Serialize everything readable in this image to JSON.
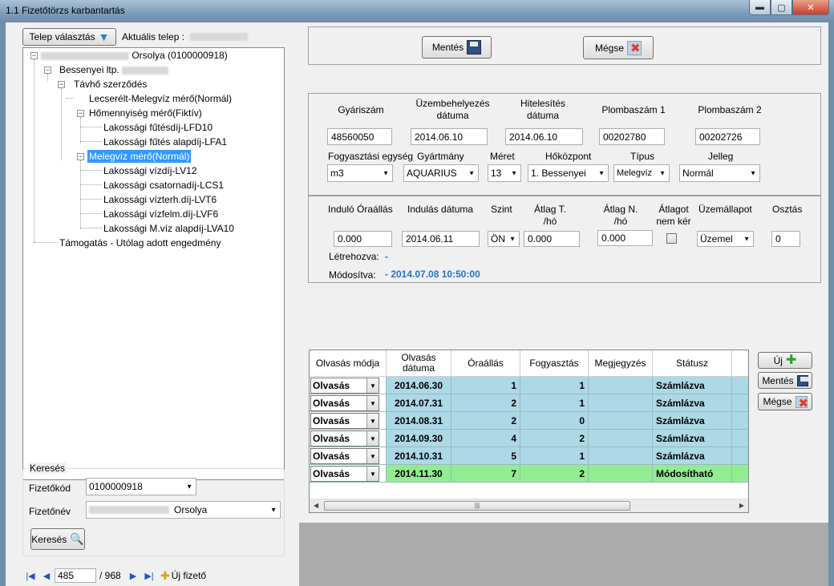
{
  "window": {
    "title": "1.1 Fizetőtörzs karbantartás",
    "buttons": {
      "minimize": "▬",
      "maximize": "▢",
      "close": "✕"
    }
  },
  "left": {
    "telep_button": "Telep választás",
    "aktualis_label": "Aktuális telep :",
    "tree": {
      "root": "Orsolya (0100000918)",
      "bessenyei": "Bessenyei ltp.",
      "tavho": "Távhő szerződés",
      "lecserelt": "Lecserélt-Melegvíz mérő(Normál)",
      "homennyiseg": "Hőmennyiség mérő(Fiktív)",
      "futesdij": "Lakossági fűtésdíj-LFD10",
      "futesalap": "Lakossági fűtés alapdíj-LFA1",
      "melegviz": "Melegvíz mérő(Normál)",
      "vizdij": "Lakossági vízdíj-LV12",
      "csatorna": "Lakossági csatornadíj-LCS1",
      "vizterh": "Lakossági vízterh.díj-LVT6",
      "vizfelm": "Lakossági vízfelm.díj-LVF6",
      "mviz": "Lakossági M.víz alapdíj-LVA10",
      "tamogatas": "Támogatás - Utólag adott engedmény"
    },
    "search": {
      "group_title": "Keresés",
      "kod_label": "Fizetőkód",
      "kod_value": "0100000918",
      "nev_label": "Fizetőnév",
      "nev_value": "Orsolya",
      "button": "Keresés"
    },
    "nav": {
      "current": "485",
      "total": "/ 968",
      "new_payer": "Új fizető"
    }
  },
  "toolbar": {
    "save": "Mentés",
    "cancel": "Mégse"
  },
  "meter": {
    "headers": {
      "gyariszam": "Gyáriszám",
      "uzembe": "Üzembehelyezés dátuma",
      "hiteles": "Hitelesítés dátuma",
      "plomba1": "Plombaszám 1",
      "plomba2": "Plombaszám 2",
      "fogy_egyseg": "Fogyasztási egység",
      "gyartmany": "Gyártmány",
      "meret": "Méret",
      "hokozpont": "Hőközpont",
      "tipus": "Típus",
      "jelleg": "Jelleg"
    },
    "values": {
      "gyariszam": "48560050",
      "uzembe": "2014.06.10",
      "hiteles": "2014.06.10",
      "plomba1": "00202780",
      "plomba2": "00202726",
      "fogy_egyseg": "m3",
      "gyartmany": "AQUARIUS",
      "meret": "13",
      "hokozpont": "1. Bessenyei",
      "tipus": "Melegvíz",
      "jelleg": "Normál"
    }
  },
  "reading": {
    "headers": {
      "indulo": "Induló Óraállás",
      "indulas": "Indulás dátuma",
      "szint": "Szint",
      "atlag_t": "Átlag T. /hó",
      "atlag_n": "Átlag N. /hó",
      "atlagot": "Átlagot nem kér",
      "uzemallapot": "Üzemállapot",
      "osztas": "Osztás"
    },
    "values": {
      "indulo": "0.000",
      "indulas": "2014.06.11",
      "szint": "ÖN",
      "atlag_t": "0.000",
      "atlag_n": "0.000",
      "uzemallapot": "Üzemel",
      "osztas": "0"
    },
    "letrehozva_label": "Létrehozva:",
    "letrehozva_value": "-",
    "modositva_label": "Módosítva:",
    "modositva_value": "- 2014.07.08 10:50:00"
  },
  "grid": {
    "columns": [
      "Olvasás módja",
      "Olvasás dátuma",
      "Óraállás",
      "Fogyasztás",
      "Megjegyzés",
      "Státusz"
    ],
    "rows": [
      {
        "mode": "Olvasás",
        "date": "2014.06.30",
        "reading": "1",
        "consumption": "1",
        "note": "",
        "status": "Számlázva",
        "color": "#add8e6"
      },
      {
        "mode": "Olvasás",
        "date": "2014.07.31",
        "reading": "2",
        "consumption": "1",
        "note": "",
        "status": "Számlázva",
        "color": "#add8e6"
      },
      {
        "mode": "Olvasás",
        "date": "2014.08.31",
        "reading": "2",
        "consumption": "0",
        "note": "",
        "status": "Számlázva",
        "color": "#add8e6"
      },
      {
        "mode": "Olvasás",
        "date": "2014.09.30",
        "reading": "4",
        "consumption": "2",
        "note": "",
        "status": "Számlázva",
        "color": "#add8e6"
      },
      {
        "mode": "Olvasás",
        "date": "2014.10.31",
        "reading": "5",
        "consumption": "1",
        "note": "",
        "status": "Számlázva",
        "color": "#add8e6"
      },
      {
        "mode": "Olvasás",
        "date": "2014.11.30",
        "reading": "7",
        "consumption": "2",
        "note": "",
        "status": "Módosítható",
        "color": "#90ee90"
      }
    ],
    "buttons": {
      "new": "Új",
      "save": "Mentés",
      "cancel": "Mégse"
    }
  }
}
